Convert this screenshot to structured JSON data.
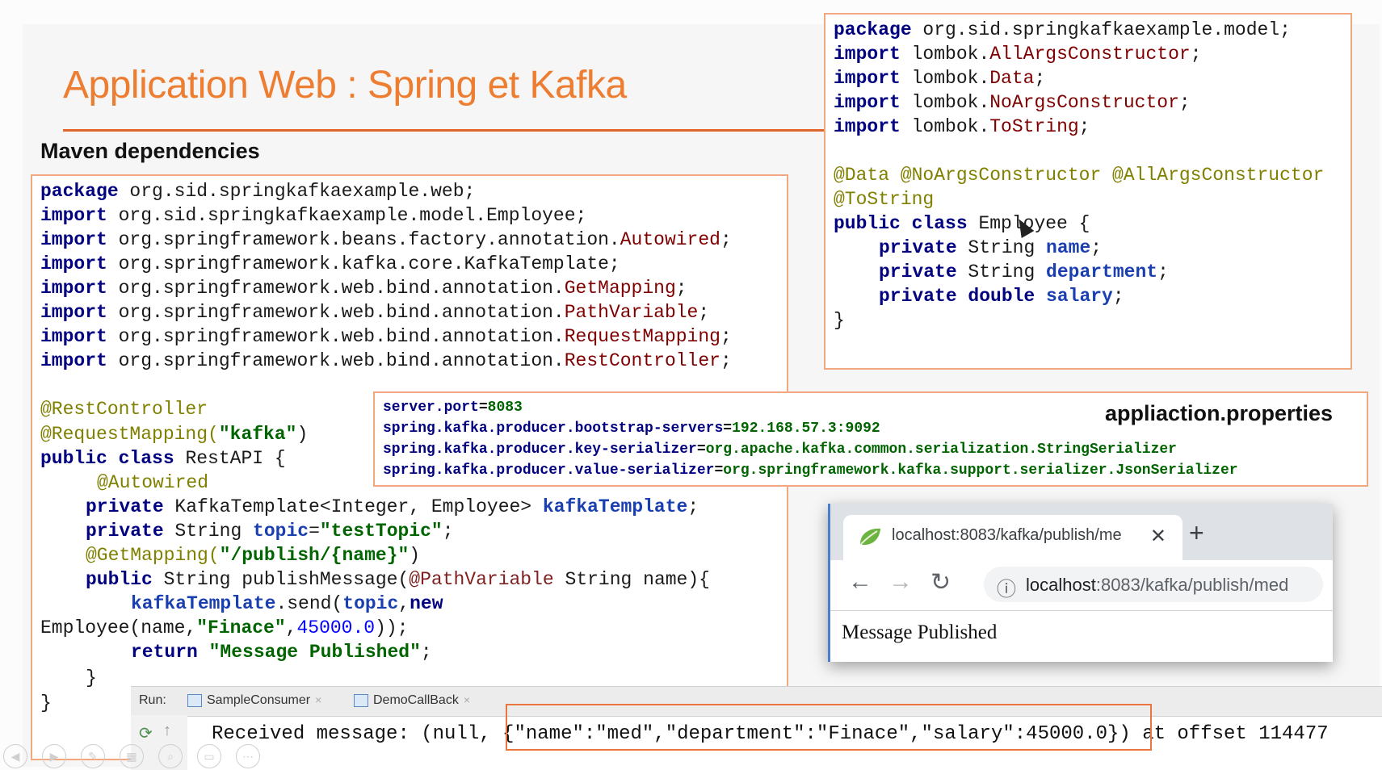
{
  "slide": {
    "title": "Application Web : Spring et Kafka",
    "subtitle": "Maven dependencies"
  },
  "restapi_code": {
    "l1_kw": "package",
    "l1_rest": " org.sid.springkafkaexample.web;",
    "l2_kw": "import",
    "l2_rest": " org.sid.springkafkaexample.model.Employee;",
    "l3_kw": "import",
    "l3_pre": " org.springframework.beans.factory.annotation.",
    "l3_cls": "Autowired",
    "l3_end": ";",
    "l4_kw": "import",
    "l4_rest": " org.springframework.kafka.core.KafkaTemplate;",
    "l5_kw": "import",
    "l5_pre": " org.springframework.web.bind.annotation.",
    "l5_cls": "GetMapping",
    "l5_end": ";",
    "l6_kw": "import",
    "l6_pre": " org.springframework.web.bind.annotation.",
    "l6_cls": "PathVariable",
    "l6_end": ";",
    "l7_kw": "import",
    "l7_pre": " org.springframework.web.bind.annotation.",
    "l7_cls": "RequestMapping",
    "l7_end": ";",
    "l8_kw": "import",
    "l8_pre": " org.springframework.web.bind.annotation.",
    "l8_cls": "RestController",
    "l8_end": ";",
    "l9_ann": "@RestController",
    "l10_ann": "@RequestMapping(",
    "l10_str": "\"kafka\"",
    "l10_end": ")",
    "l11_kw": "public class",
    "l11_rest": " RestAPI {",
    "l12_ann": "@Autowired",
    "l13_kw": "private",
    "l13_rest": " KafkaTemplate<Integer, Employee> ",
    "l13_field": "kafkaTemplate",
    "l13_end": ";",
    "l14_kw": "private",
    "l14_rest": " String ",
    "l14_field": "topic",
    "l14_eq": "=",
    "l14_str": "\"testTopic\"",
    "l14_end": ";",
    "l15_ann": "@GetMapping(",
    "l15_str": "\"/publish/{name}\"",
    "l15_end": ")",
    "l16_kw": "public",
    "l16_rest": " String publishMessage(",
    "l16_ann": "@PathVariable",
    "l16_end": " String name){",
    "l17_field": "kafkaTemplate",
    "l17_rest": ".send(",
    "l17_field2": "topic",
    "l17_comma": ",",
    "l17_kw": "new",
    "l18_pre": "Employee(name,",
    "l18_str": "\"Finace\"",
    "l18_comma": ",",
    "l18_num": "45000.0",
    "l18_end": "));",
    "l19_kw": "return",
    "l19_str": " \"Message Published\"",
    "l19_end": ";",
    "l20": "}",
    "l21": "}"
  },
  "employee_code": {
    "l1_kw": "package",
    "l1_rest": " org.sid.springkafkaexample.model;",
    "l2_kw": "import",
    "l2_pre": " lombok.",
    "l2_cls": "AllArgsConstructor",
    "l2_end": ";",
    "l3_kw": "import",
    "l3_pre": " lombok.",
    "l3_cls": "Data",
    "l3_end": ";",
    "l4_kw": "import",
    "l4_pre": " lombok.",
    "l4_cls": "NoArgsConstructor",
    "l4_end": ";",
    "l5_kw": "import",
    "l5_pre": " lombok.",
    "l5_cls": "ToString",
    "l5_end": ";",
    "l6_ann": "@Data @NoArgsConstructor @AllArgsConstructor",
    "l7_ann": "@ToString",
    "l8_kw": "public class",
    "l8_rest": " Employee {",
    "l9_kw": "private",
    "l9_rest": " String ",
    "l9_field": "name",
    "l9_end": ";",
    "l10_kw": "private",
    "l10_rest": " String ",
    "l10_field": "department",
    "l10_end": ";",
    "l11_kw": "private double",
    "l11_rest": " ",
    "l11_field": "salary",
    "l11_end": ";",
    "l12": "}"
  },
  "properties": {
    "title": "appliaction.properties",
    "p1_key": "server.port",
    "p1_val": "8083",
    "p2_key": "spring.kafka.producer.bootstrap-servers",
    "p2_val": "192.168.57.3:9092",
    "p3_key": "spring.kafka.producer.key-serializer",
    "p3_val": "org.apache.kafka.common.serialization.StringSerializer",
    "p4_key": "spring.kafka.producer.value-serializer",
    "p4_val": "org.springframework.kafka.support.serializer.JsonSerializer",
    "eq": "="
  },
  "browser": {
    "tab_title": "localhost:8083/kafka/publish/me",
    "close": "✕",
    "new_tab": "+",
    "back": "←",
    "forward": "→",
    "reload": "↻",
    "info": "ⓘ",
    "url_host": "localhost",
    "url_path": ":8083/kafka/publish/med",
    "page_text": "Message Published"
  },
  "console": {
    "run_label": "Run:",
    "tab1": "SampleConsumer",
    "tab2": "DemoCallBack",
    "tab_close": "×",
    "output": "Received message: (null, {\"name\":\"med\",\"department\":\"Finace\",\"salary\":45000.0}) at offset 114477",
    "rerun": "⟳",
    "up": "↑"
  },
  "colors": {
    "title": "#ed7d31",
    "box_border": "#f2a77f",
    "highlight": "#e8763e"
  }
}
